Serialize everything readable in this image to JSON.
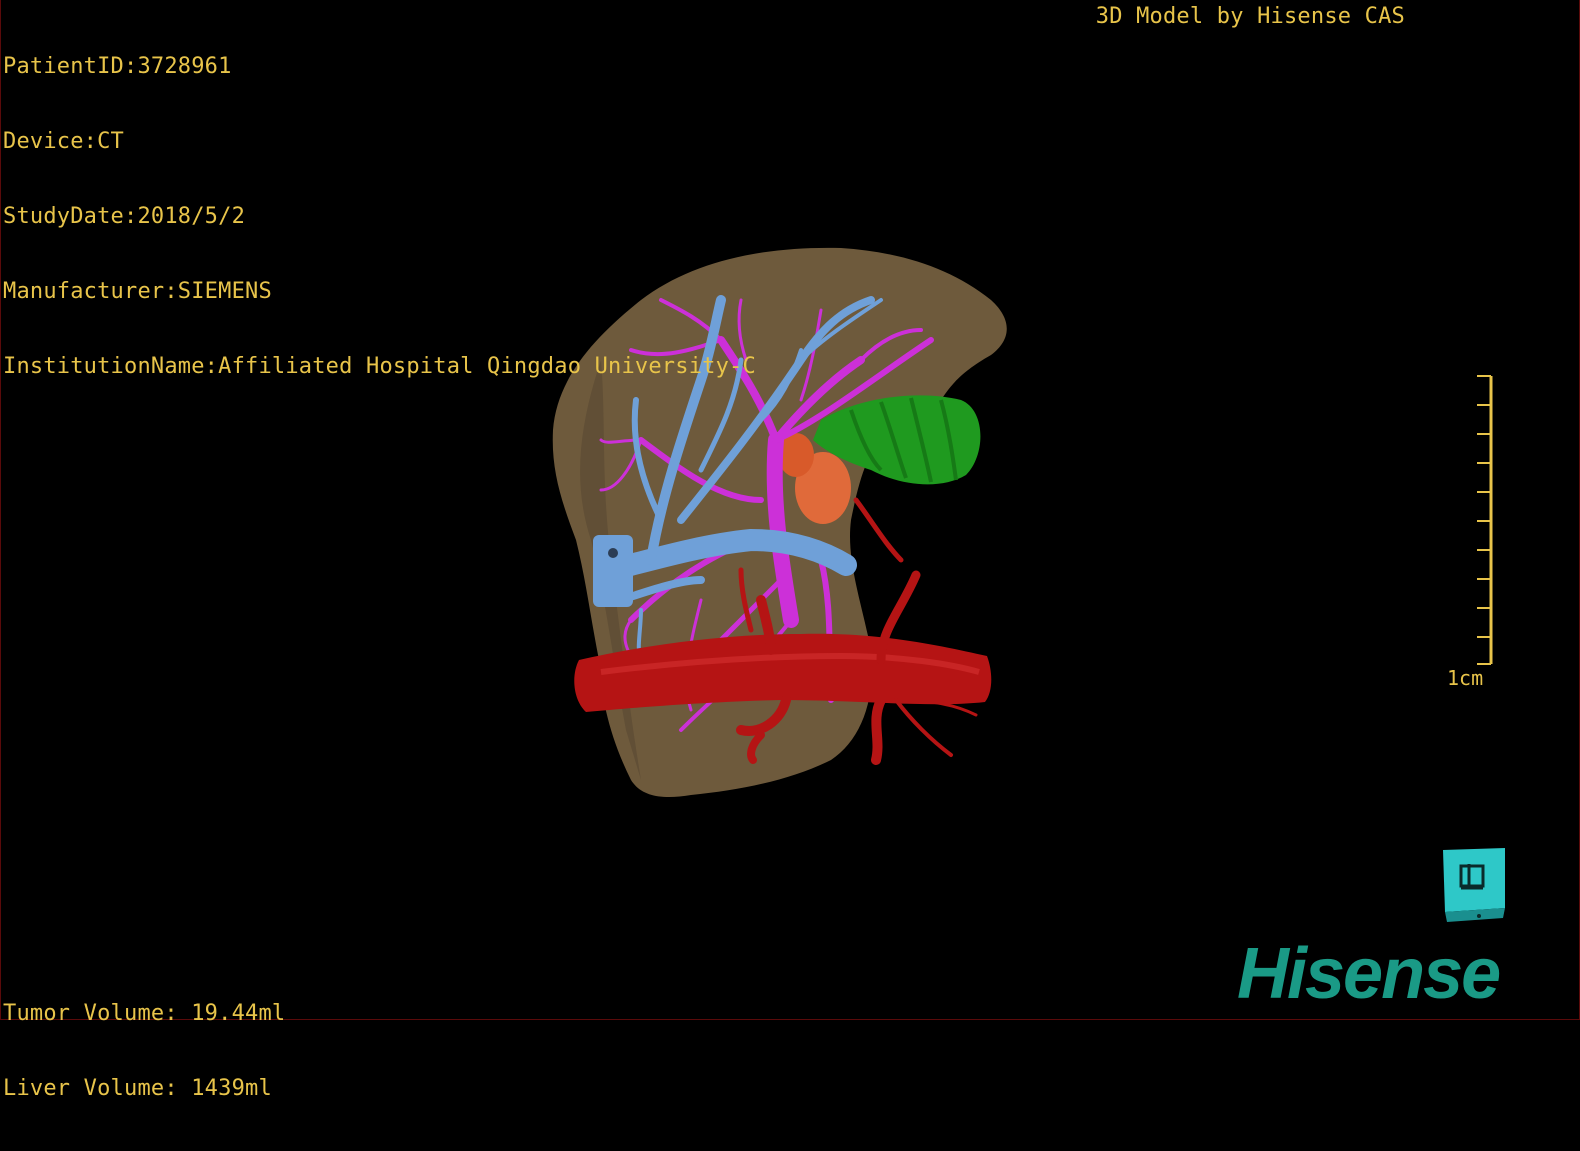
{
  "header": {
    "patient_id": "PatientID:3728961",
    "device": "Device:CT",
    "study_date": "StudyDate:2018/5/2",
    "manufacturer": "Manufacturer:SIEMENS",
    "institution": "InstitutionName:Affiliated Hospital Qingdao University-C",
    "model_credit": "3D Model by Hisense CAS"
  },
  "footer": {
    "tumor_volume": "Tumor Volume: 19.44ml",
    "liver_volume": "Liver Volume: 1439ml"
  },
  "scale": {
    "label": "1cm",
    "ticks": 10
  },
  "brand": {
    "logo_text": "Hisense",
    "logo_color": "#1a9a86"
  },
  "colors": {
    "text": "#e8c44a",
    "liver": "#6e5a3c",
    "portal_vein": "#cc30d8",
    "hepatic_vein": "#6fa0d8",
    "artery": "#b51414",
    "gallbladder": "#1f9a1f",
    "tumor": "#e06a3a"
  },
  "icons": {
    "orientation_cube": "orientation-cube-icon"
  }
}
